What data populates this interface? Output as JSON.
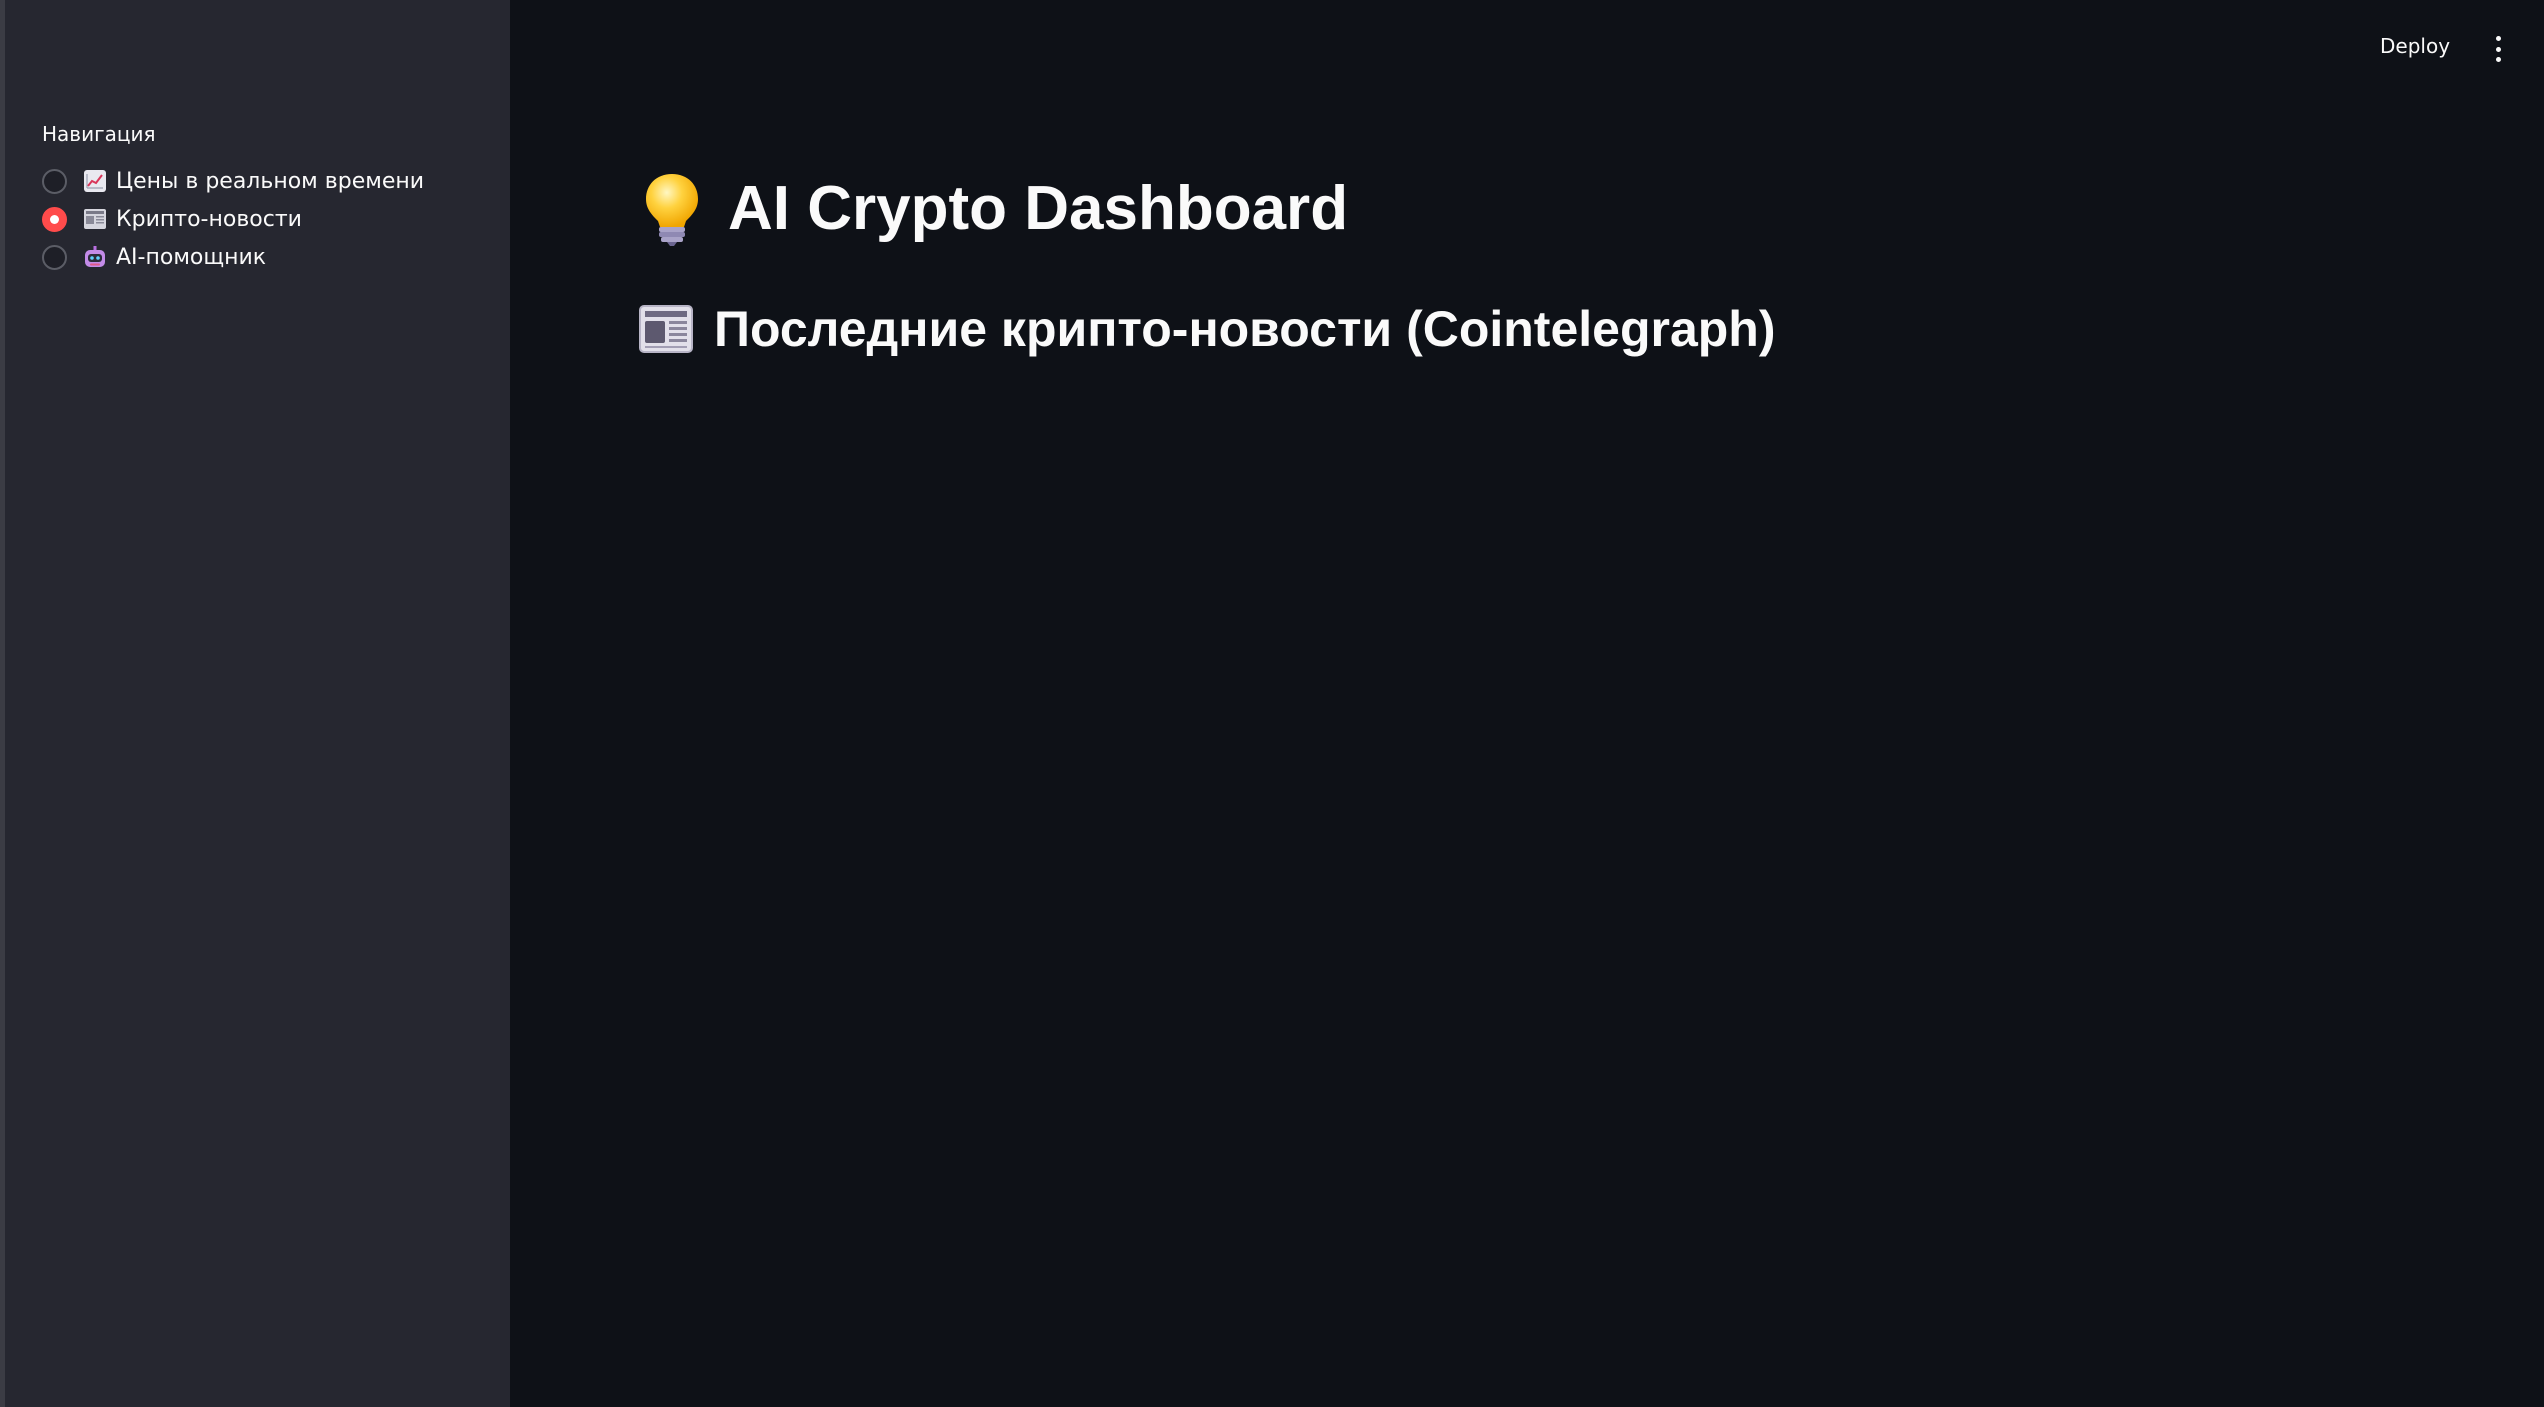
{
  "sidebar": {
    "nav_label": "Навигация",
    "items": [
      {
        "label": "Цены в реальном времени",
        "icon": "chart-increasing-icon",
        "selected": false
      },
      {
        "label": "Крипто-новости",
        "icon": "newspaper-icon",
        "selected": true
      },
      {
        "label": "AI-помощник",
        "icon": "robot-icon",
        "selected": false
      }
    ]
  },
  "toolbar": {
    "deploy_label": "Deploy",
    "menu_icon": "kebab-menu-icon"
  },
  "main": {
    "title": "AI Crypto Dashboard",
    "title_icon": "light-bulb-icon",
    "subheader": "Последние крипто-новости (Cointelegraph)",
    "subheader_icon": "newspaper-icon"
  },
  "colors": {
    "background": "#0e1117",
    "sidebar": "#262730",
    "accent": "#ff4b4b",
    "text": "#fafafa"
  }
}
